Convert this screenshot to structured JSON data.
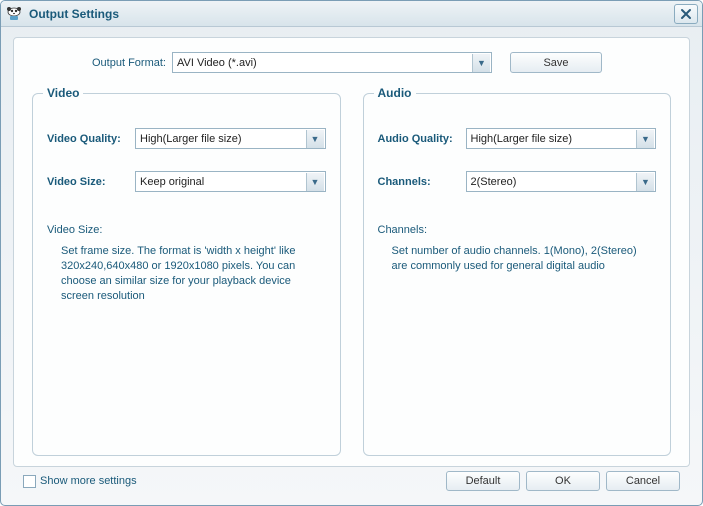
{
  "window": {
    "title": "Output Settings"
  },
  "format": {
    "label": "Output Format:",
    "value": "AVI Video (*.avi)",
    "save_label": "Save"
  },
  "video": {
    "legend": "Video",
    "quality_label": "Video Quality:",
    "quality_value": "High(Larger file size)",
    "size_label": "Video Size:",
    "size_value": "Keep original",
    "help_title": "Video Size:",
    "help_text": "Set frame size. The format is 'width x height' like 320x240,640x480 or 1920x1080 pixels. You can choose an similar size for your playback device screen resolution"
  },
  "audio": {
    "legend": "Audio",
    "quality_label": "Audio Quality:",
    "quality_value": "High(Larger file size)",
    "channels_label": "Channels:",
    "channels_value": "2(Stereo)",
    "help_title": "Channels:",
    "help_text": "Set number of audio channels. 1(Mono), 2(Stereo) are commonly used for general digital audio"
  },
  "footer": {
    "show_more_label": "Show more settings",
    "default_label": "Default",
    "ok_label": "OK",
    "cancel_label": "Cancel"
  }
}
